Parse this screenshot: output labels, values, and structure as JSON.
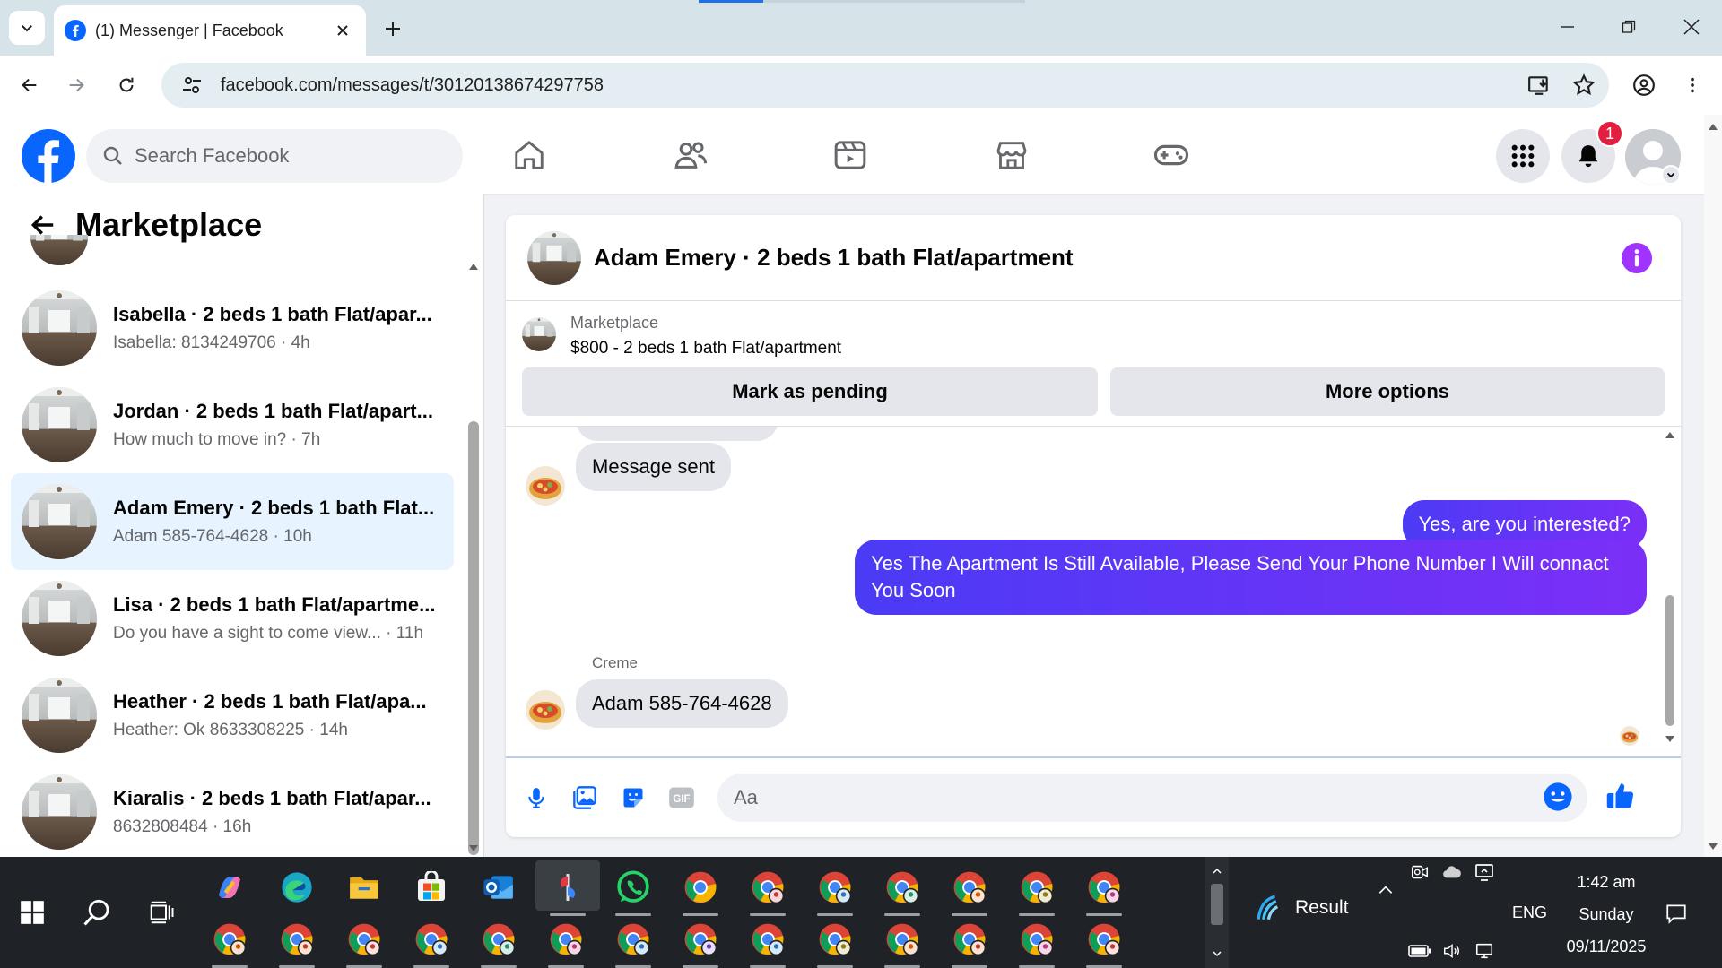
{
  "browser": {
    "tab_title": "(1) Messenger | Facebook",
    "url": "facebook.com/messages/t/30120138674297758"
  },
  "fb": {
    "search_placeholder": "Search Facebook",
    "notification_count": "1"
  },
  "sidebar": {
    "title": "Marketplace",
    "chats": [
      {
        "name": "Isabella · 2 beds 1 bath Flat/apar...",
        "preview": "Isabella: 8134249706 · 4h",
        "active": false
      },
      {
        "name": "Jordan · 2 beds 1 bath Flat/apart...",
        "preview": "How much to move in? · 7h",
        "active": false
      },
      {
        "name": "Adam Emery · 2 beds 1 bath Flat...",
        "preview": "Adam 585-764-4628 · 10h",
        "active": true
      },
      {
        "name": "Lisa · 2 beds 1 bath Flat/apartme...",
        "preview": "Do you have a sight to come view... · 11h",
        "active": false
      },
      {
        "name": "Heather · 2 beds 1 bath Flat/apa...",
        "preview": "Heather: Ok 8633308225 · 14h",
        "active": false
      },
      {
        "name": "Kiaralis · 2 beds 1 bath Flat/apar...",
        "preview": "8632808484 · 16h",
        "active": false
      }
    ]
  },
  "conversation": {
    "title": "Adam Emery · 2 beds 1 bath Flat/apartment",
    "listing_label": "Marketplace",
    "listing_price": "$800 - 2 beds 1 bath Flat/apartment",
    "mark_pending": "Mark as pending",
    "more_options": "More options",
    "messages": {
      "sent_notice": "Message sent",
      "out_1": "Yes, are you interested?",
      "out_2": "Yes The Apartment Is Still Available, Please Send Your Phone Number I Will connact You Soon",
      "sender": "Creme",
      "in_1": "Adam 585-764-4628"
    },
    "input_placeholder": "Aa"
  },
  "taskbar": {
    "weather": "Result",
    "language": "ENG",
    "time": "1:42 am",
    "day": "Sunday",
    "date": "09/11/2025"
  },
  "colors": {
    "fb_blue": "#0866ff",
    "messenger_purple": "#a033ff",
    "outgoing_bubble": "#5b3cf5",
    "active_chat_bg": "#e7f3ff",
    "badge_red": "#e41e3f"
  }
}
